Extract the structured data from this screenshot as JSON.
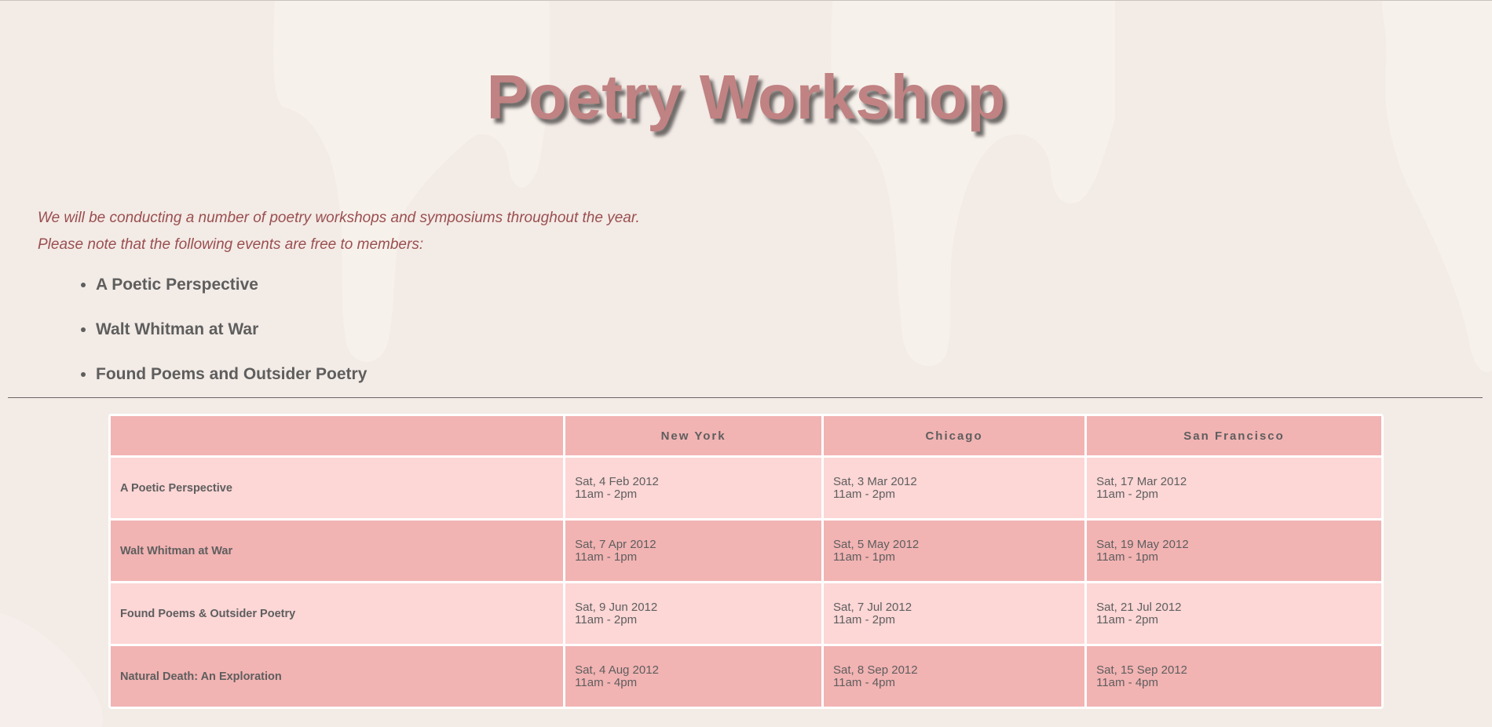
{
  "header": {
    "title": "Poetry Workshop"
  },
  "intro": {
    "line1": "We will be conducting a number of poetry workshops and symposiums throughout the year.",
    "line2": "Please note that the following events are free to members:"
  },
  "free_events": [
    "A Poetic Perspective",
    "Walt Whitman at War",
    "Found Poems and Outsider Poetry"
  ],
  "schedule": {
    "columns": [
      "",
      "New York",
      "Chicago",
      "San Francisco"
    ],
    "rows": [
      {
        "event": "A Poetic Perspective",
        "ny_date": "Sat, 4 Feb 2012",
        "ny_time": "11am - 2pm",
        "chi_date": "Sat, 3 Mar 2012",
        "chi_time": "11am - 2pm",
        "sf_date": "Sat, 17 Mar 2012",
        "sf_time": "11am - 2pm"
      },
      {
        "event": "Walt Whitman at War",
        "ny_date": "Sat, 7 Apr 2012",
        "ny_time": "11am - 1pm",
        "chi_date": "Sat, 5 May 2012",
        "chi_time": "11am - 1pm",
        "sf_date": "Sat, 19 May 2012",
        "sf_time": "11am - 1pm"
      },
      {
        "event": "Found Poems & Outsider Poetry",
        "ny_date": "Sat, 9 Jun 2012",
        "ny_time": "11am - 2pm",
        "chi_date": "Sat, 7 Jul 2012",
        "chi_time": "11am - 2pm",
        "sf_date": "Sat, 21 Jul 2012",
        "sf_time": "11am - 2pm"
      },
      {
        "event": "Natural Death: An Exploration",
        "ny_date": "Sat, 4 Aug 2012",
        "ny_time": "11am - 4pm",
        "chi_date": "Sat, 8 Sep 2012",
        "chi_time": "11am - 4pm",
        "sf_date": "Sat, 15 Sep 2012",
        "sf_time": "11am - 4pm"
      }
    ]
  },
  "colors": {
    "title": "#c08282",
    "intro_text": "#9a4f50",
    "body_text": "#5e5e5e",
    "table_dark": "#f2b3b3",
    "table_light": "#fdd6d6",
    "background": "#f3ebe6"
  }
}
